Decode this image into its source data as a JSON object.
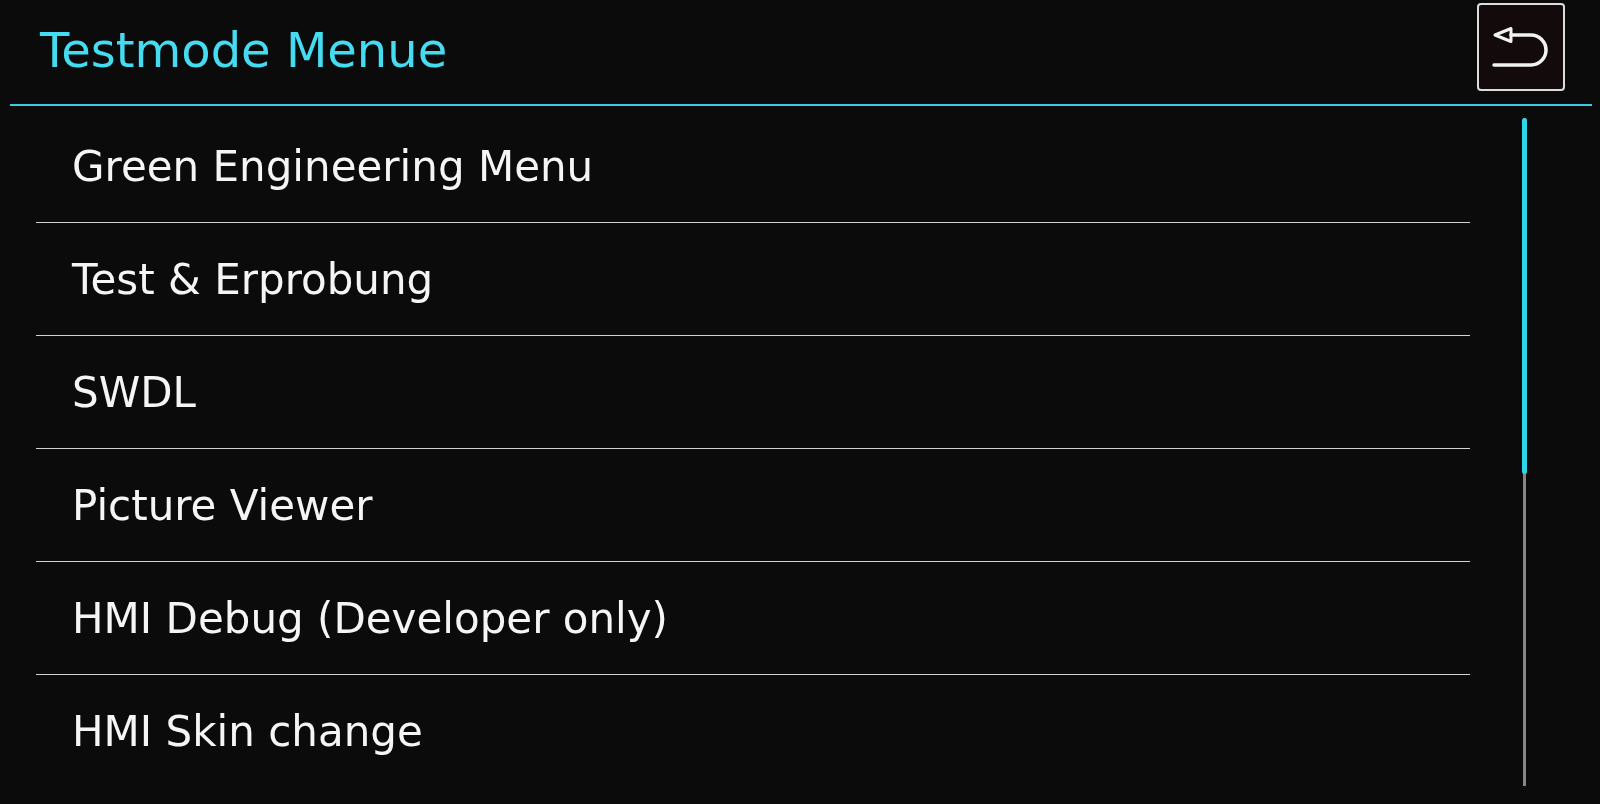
{
  "header": {
    "title": "Testmode Menue"
  },
  "menu": {
    "items": [
      {
        "label": "Green Engineering Menu"
      },
      {
        "label": "Test & Erprobung"
      },
      {
        "label": "SWDL"
      },
      {
        "label": "Picture Viewer"
      },
      {
        "label": "HMI Debug (Developer only)"
      },
      {
        "label": "HMI Skin change"
      }
    ]
  }
}
